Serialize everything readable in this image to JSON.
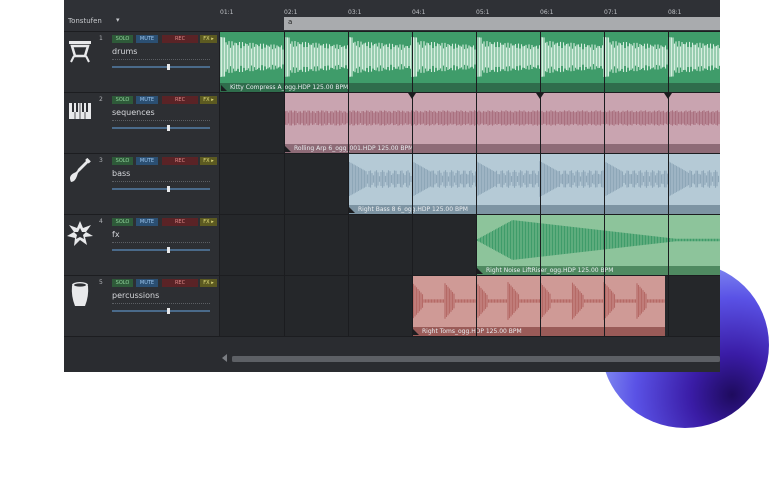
{
  "ruler": {
    "label": "Tonstufen",
    "dropdown": "▾",
    "marks": [
      "01:1",
      "02:1",
      "03:1",
      "04:1",
      "05:1",
      "06:1",
      "07:1",
      "08:1"
    ],
    "range_marker": "a"
  },
  "tracks": [
    {
      "number": "1",
      "name": "drums",
      "icon": "drum-icon",
      "solo": "SOLO",
      "mute": "MUTE",
      "rec": "REC",
      "fx": "FX ▸",
      "volume": 0.56
    },
    {
      "number": "2",
      "name": "sequences",
      "icon": "keyboard-icon",
      "solo": "SOLO",
      "mute": "MUTE",
      "rec": "REC",
      "fx": "FX ▸",
      "volume": 0.56
    },
    {
      "number": "3",
      "name": "bass",
      "icon": "bass-guitar-icon",
      "solo": "SOLO",
      "mute": "MUTE",
      "rec": "REC",
      "fx": "FX ▸",
      "volume": 0.56
    },
    {
      "number": "4",
      "name": "fx",
      "icon": "explosion-icon",
      "solo": "SOLO",
      "mute": "MUTE",
      "rec": "REC",
      "fx": "FX ▸",
      "volume": 0.56
    },
    {
      "number": "5",
      "name": "percussions",
      "icon": "conga-icon",
      "solo": "SOLO",
      "mute": "MUTE",
      "rec": "REC",
      "fx": "FX ▸",
      "volume": 0.56
    }
  ],
  "clips": [
    {
      "label": "Kitty Compress A_ogg.HDP  125.00 BPM",
      "color": "#3f9c6a"
    },
    {
      "label": "Rolling Arp 6_ogg_001.HDP  125.00 BPM",
      "color": "#c9a4b0"
    },
    {
      "label": "Right Bass 8 6_ogg.HDP  125.00 BPM",
      "color": "#b5cad6"
    },
    {
      "label": "Right Noise LiftRiser_ogg.HDP  125.00 BPM",
      "color": "#8dc49b"
    },
    {
      "label": "Right Toms_ogg.HDP  125.00 BPM",
      "color": "#cf9a96"
    }
  ]
}
